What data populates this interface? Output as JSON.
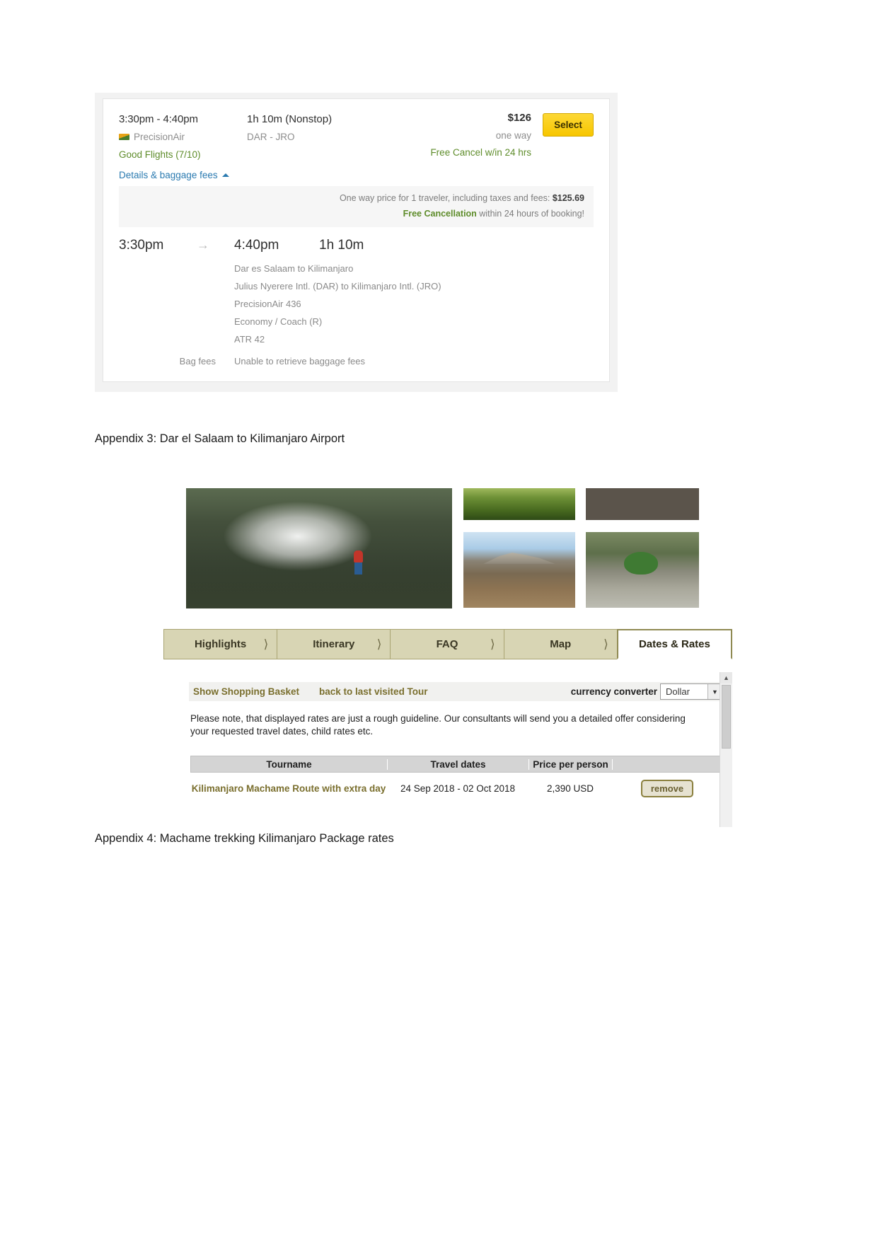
{
  "flight_card": {
    "times": "3:30pm - 4:40pm",
    "airline": "PrecisionAir",
    "airline_logo_icon": "precisionair-logo-icon",
    "rating": "Good Flights (7/10)",
    "duration": "1h 10m (Nonstop)",
    "route": "DAR - JRO",
    "price": "$126",
    "price_note": "one way",
    "free_cancel": "Free Cancel w/in 24 hrs",
    "select_label": "Select",
    "details_link": "Details & baggage fees",
    "details_caret_icon": "caret-up-icon",
    "price_bar": {
      "line1_text": "One way price for 1 traveler, including taxes and fees: ",
      "line1_amount": "$125.69",
      "line2_strong": "Free Cancellation",
      "line2_text": " within 24 hours of booking!"
    },
    "segment": {
      "depart": "3:30pm",
      "arrow_icon": "arrow-right-icon",
      "arrive": "4:40pm",
      "length": "1h 10m",
      "details": [
        "Dar es Salaam to Kilimanjaro",
        "Julius Nyerere Intl. (DAR) to Kilimanjaro Intl. (JRO)",
        "PrecisionAir 436",
        "Economy / Coach (R)",
        "ATR 42"
      ],
      "bag_label": "Bag fees",
      "bag_value": "Unable to retrieve baggage fees"
    }
  },
  "captions": {
    "appendix3": "Appendix 3: Dar el Salaam to Kilimanjaro Airport",
    "appendix4": "Appendix 4: Machame trekking Kilimanjaro Package rates"
  },
  "gallery": {
    "photos": [
      {
        "name": "kilimanjaro-crater-hiker-photo"
      },
      {
        "name": "rainforest-canopy-photo"
      },
      {
        "name": "rock-face-photo"
      },
      {
        "name": "kibo-summit-plateau-photo"
      },
      {
        "name": "green-tent-camp-stream-photo"
      }
    ]
  },
  "tabs": [
    {
      "label": "Highlights",
      "active": false,
      "chevron_icon": "chevron-right-icon"
    },
    {
      "label": "Itinerary",
      "active": false,
      "chevron_icon": "chevron-right-icon"
    },
    {
      "label": "FAQ",
      "active": false,
      "chevron_icon": "chevron-right-icon"
    },
    {
      "label": "Map",
      "active": false,
      "chevron_icon": "chevron-right-icon"
    },
    {
      "label": "Dates & Rates",
      "active": true,
      "chevron_icon": ""
    }
  ],
  "rates_panel": {
    "toolbar": {
      "show_basket": "Show Shopping Basket",
      "back_to_tour": "back to last visited Tour",
      "currency_label": "currency converter",
      "currency_value": "Dollar",
      "currency_arrow_icon": "chevron-down-icon"
    },
    "note": "Please note, that displayed rates are just a rough guideline. Our consultants will send you a detailed offer considering your requested travel dates, child rates etc.",
    "table": {
      "headers": [
        "Tourname",
        "Travel dates",
        "Price per person",
        ""
      ],
      "rows": [
        {
          "tourname": "Kilimanjaro Machame Route with extra day",
          "travel_dates": "24 Sep 2018 - 02 Oct 2018",
          "price": "2,390 USD",
          "action": "remove"
        }
      ]
    },
    "scrollbar": {
      "up_icon": "chevron-up-icon",
      "down_icon": "chevron-down-icon"
    }
  },
  "colors": {
    "accent_yellow": "#f7c600",
    "green": "#5e8c2a",
    "link_blue": "#2a7ab0",
    "tab_olive": "#d8d5b4",
    "gold_text": "#7a6f2e"
  }
}
